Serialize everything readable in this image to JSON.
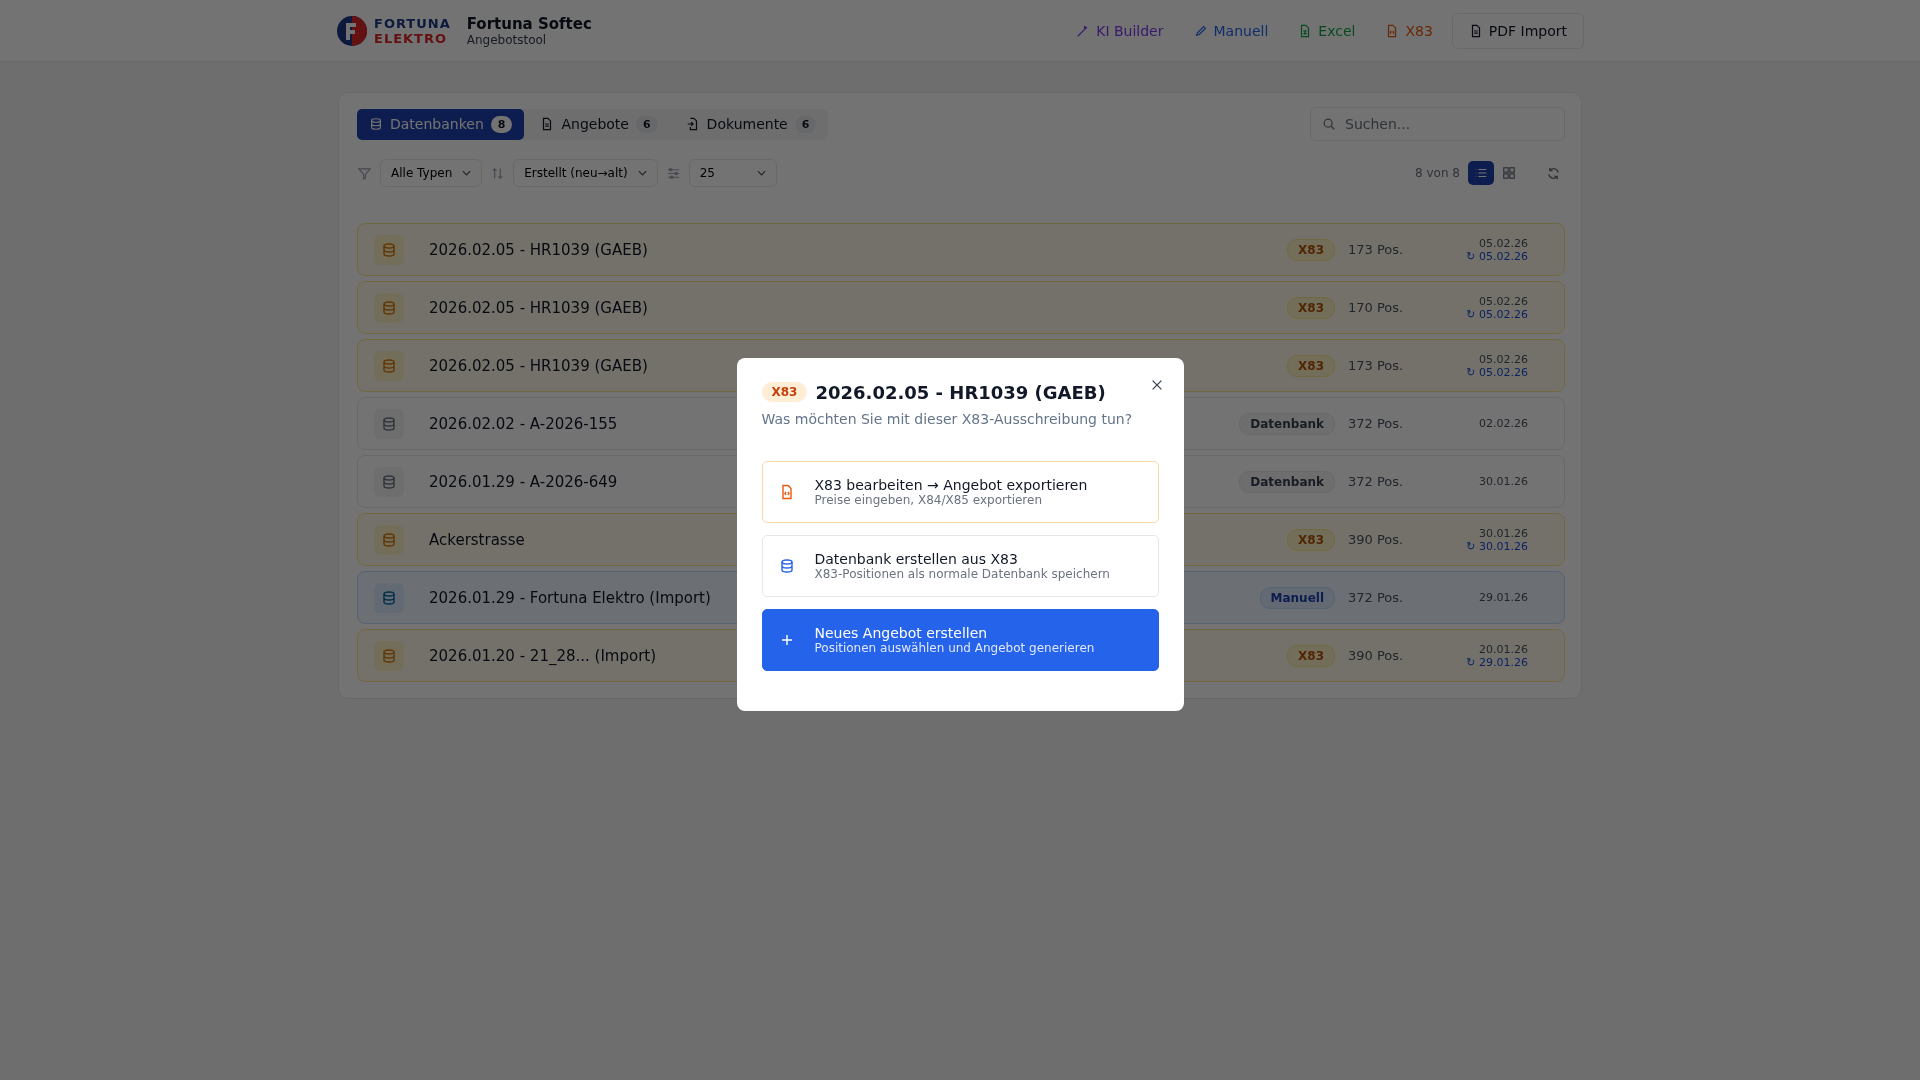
{
  "header": {
    "logo_top": "FORTUNA",
    "logo_bottom": "ELEKTRO",
    "title": "Fortuna Softec",
    "subtitle": "Angebotstool",
    "nav": [
      {
        "label": "KI Builder",
        "kind": "ai"
      },
      {
        "label": "Manuell",
        "kind": "pen"
      },
      {
        "label": "Excel",
        "kind": "sheet"
      },
      {
        "label": "X83",
        "kind": "code"
      },
      {
        "label": "PDF Import",
        "kind": "pdf"
      }
    ]
  },
  "tabs": [
    {
      "label": "Datenbanken",
      "count": "8",
      "kind": "db",
      "selected": true
    },
    {
      "label": "Angebote",
      "count": "6",
      "kind": "doc",
      "selected": false
    },
    {
      "label": "Dokumente",
      "count": "6",
      "kind": "import",
      "selected": false
    }
  ],
  "search": {
    "placeholder": "Suchen..."
  },
  "filters": {
    "type": "Alle Typen",
    "sort": "Erstellt (neu→alt)",
    "page_size": "25",
    "count": "8 von 8",
    "views": [
      {
        "kind": "list",
        "selected": true
      },
      {
        "kind": "grid",
        "selected": false
      }
    ]
  },
  "rows": [
    {
      "title": "2026.02.05 - HR1039 (GAEB)",
      "kind": "x83",
      "badge": "X83",
      "positions": "173 Pos.",
      "created": "05.02.26",
      "updated": "↻ 05.02.26"
    },
    {
      "title": "2026.02.05 - HR1039 (GAEB)",
      "kind": "x83",
      "badge": "X83",
      "positions": "170 Pos.",
      "created": "05.02.26",
      "updated": "↻ 05.02.26"
    },
    {
      "title": "2026.02.05 - HR1039 (GAEB)",
      "kind": "x83",
      "badge": "X83",
      "positions": "173 Pos.",
      "created": "05.02.26",
      "updated": "↻ 05.02.26"
    },
    {
      "title": "2026.02.02 - A-2026-155",
      "kind": "db",
      "badge": "Datenbank",
      "positions": "372 Pos.",
      "created": "02.02.26"
    },
    {
      "title": "2026.01.29 - A-2026-649",
      "kind": "db",
      "badge": "Datenbank",
      "positions": "372 Pos.",
      "created": "30.01.26"
    },
    {
      "title": "Ackerstrasse",
      "kind": "x83",
      "badge": "X83",
      "positions": "390 Pos.",
      "created": "30.01.26",
      "updated": "↻ 30.01.26"
    },
    {
      "title": "2026.01.29 - Fortuna Elektro (Import)",
      "kind": "manual",
      "badge": "Manuell",
      "positions": "372 Pos.",
      "created": "29.01.26"
    },
    {
      "title": "2026.01.20 - 21_28... (Import)",
      "kind": "x83",
      "badge": "X83",
      "positions": "390 Pos.",
      "created": "20.01.26",
      "updated": "↻ 29.01.26"
    }
  ],
  "dialog": {
    "badge": "X83",
    "title": "2026.02.05 - HR1039 (GAEB)",
    "question": "Was möchten Sie mit dieser X83-Ausschreibung tun?",
    "options": [
      {
        "kind": "x83",
        "title": "X83 bearbeiten → Angebot exportieren",
        "hint": "Preise eingeben, X84/X85 exportieren"
      },
      {
        "kind": "db",
        "title": "Datenbank erstellen aus X83",
        "hint": "X83-Positionen als normale Datenbank speichern"
      },
      {
        "kind": "new",
        "title": "Neues Angebot erstellen",
        "hint": "Positionen auswählen und Angebot generieren"
      }
    ]
  }
}
